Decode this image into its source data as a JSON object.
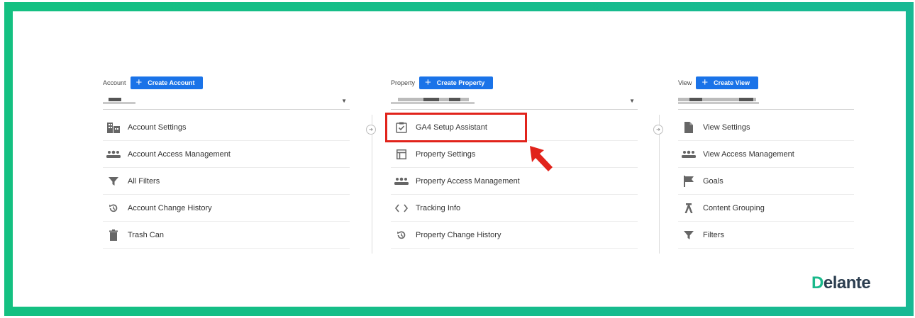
{
  "account": {
    "label": "Account",
    "create_label": "Create Account",
    "items": [
      {
        "label": "Account Settings",
        "icon": "building-icon"
      },
      {
        "label": "Account Access Management",
        "icon": "people-icon"
      },
      {
        "label": "All Filters",
        "icon": "filter-icon"
      },
      {
        "label": "Account Change History",
        "icon": "history-icon"
      },
      {
        "label": "Trash Can",
        "icon": "trash-icon"
      }
    ]
  },
  "property": {
    "label": "Property",
    "create_label": "Create Property",
    "items": [
      {
        "label": "GA4 Setup Assistant",
        "icon": "checkbox-icon"
      },
      {
        "label": "Property Settings",
        "icon": "layout-icon"
      },
      {
        "label": "Property Access Management",
        "icon": "people-icon"
      },
      {
        "label": "Tracking Info",
        "icon": "code-icon"
      },
      {
        "label": "Property Change History",
        "icon": "history-icon"
      }
    ]
  },
  "view": {
    "label": "View",
    "create_label": "Create View",
    "items": [
      {
        "label": "View Settings",
        "icon": "document-icon"
      },
      {
        "label": "View Access Management",
        "icon": "people-icon"
      },
      {
        "label": "Goals",
        "icon": "flag-icon"
      },
      {
        "label": "Content Grouping",
        "icon": "grouping-icon"
      },
      {
        "label": "Filters",
        "icon": "filter-icon"
      }
    ]
  },
  "logo": {
    "first_letter": "D",
    "rest": "elante"
  },
  "colors": {
    "frame": "#14c081",
    "button": "#1a73e8",
    "highlight": "#e1231b",
    "logo_accent": "#1ab98b"
  }
}
